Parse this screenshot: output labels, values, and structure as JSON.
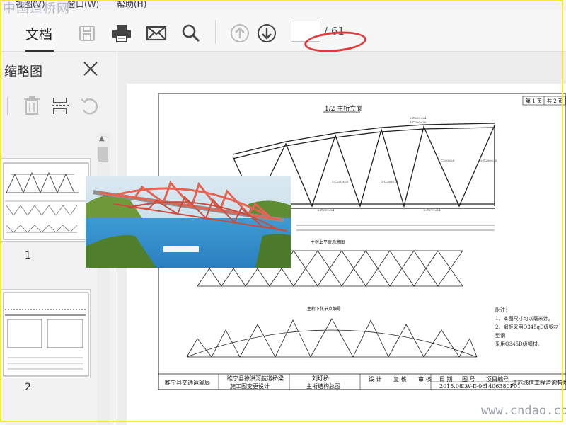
{
  "watermark_top": "中国道桥网",
  "watermark_bottom": "www.cndao.com",
  "menu": {
    "view": "视图(V)",
    "window": "窗口(W)",
    "help": "帮助(H)"
  },
  "toolbar": {
    "tab_document": "文档",
    "page_current": "",
    "page_total": "/ 61"
  },
  "sidebar": {
    "title": "缩略图",
    "thumbnails": [
      {
        "label": "1"
      },
      {
        "label": "2"
      }
    ]
  },
  "drawing": {
    "sheet": {
      "page": "第 1 页",
      "pages": "共 2 页"
    },
    "main_view": "1/2 主桁立面",
    "upper_plan": "主桁上平联示意图",
    "lower_plan": "主桁下弦节点编号",
    "notes_title": "附注：",
    "note_1": "1、本图尺寸均以毫米计。",
    "note_2": "2、钢板采用Q345qD级钢材，型钢",
    "note_3": "采用Q345D级钢材。",
    "title_block": {
      "owner": "睢宁县交通运输局",
      "project_line1": "睢宁县徐洪河航道桥梁",
      "project_line2": "施工图变更设计",
      "bridge_name": "刘圩桥",
      "drawing_title": "主桁结构总图",
      "design": "设 计",
      "review": "复 核",
      "check": "审 核",
      "date_label": "日 期",
      "drawing_no_label": "图 号",
      "project_no_label": "项目编号",
      "date": "2015.08",
      "drawing_no": "LW-Ⅱ-06",
      "project_no": "1406380P01",
      "company": "江苏纬信工程咨询有限公司"
    }
  }
}
